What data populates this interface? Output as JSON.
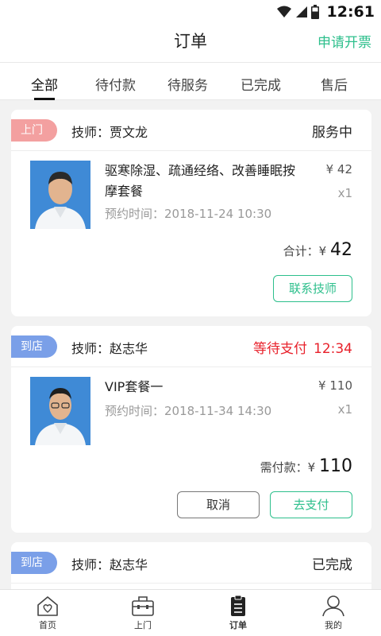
{
  "status_bar": {
    "time": "12:61"
  },
  "nav": {
    "title": "订单",
    "action": "申请开票"
  },
  "tabs": [
    "全部",
    "待付款",
    "待服务",
    "已完成",
    "售后"
  ],
  "orders": [
    {
      "badge": "上门",
      "badge_color": "#f3a0a0",
      "technician": "技师：贾文龙",
      "state": "服务中",
      "item_name": "驱寒除湿、疏通经络、改善睡眠按摩套餐",
      "item_time": "预约时间：2018-11-24 10:30",
      "price": "¥ 42",
      "qty": "x1",
      "total_label": "合计：",
      "total_currency": "¥",
      "total_value": "42",
      "button_primary": "联系技师"
    },
    {
      "badge": "到店",
      "badge_color": "#7a9fe8",
      "technician": "技师：赵志华",
      "state": "等待支付",
      "countdown": "12:34",
      "state_color": "#e8212b",
      "item_name": "VIP套餐一",
      "item_time": "预约时间：2018-11-34 14:30",
      "price": "¥ 110",
      "qty": "x1",
      "total_label": "需付款：",
      "total_currency": "¥",
      "total_value": "110",
      "button_secondary": "取消",
      "button_primary": "去支付"
    },
    {
      "badge": "到店",
      "badge_color": "#7a9fe8",
      "technician": "技师：赵志华",
      "state": "已完成"
    }
  ],
  "tabbar": [
    {
      "label": "首页",
      "icon": "home-heart-icon"
    },
    {
      "label": "上门",
      "icon": "toolbox-icon"
    },
    {
      "label": "订单",
      "icon": "clipboard-icon"
    },
    {
      "label": "我的",
      "icon": "user-icon"
    }
  ],
  "colors": {
    "accent": "#2dbf8c",
    "alert": "#e8212b"
  }
}
